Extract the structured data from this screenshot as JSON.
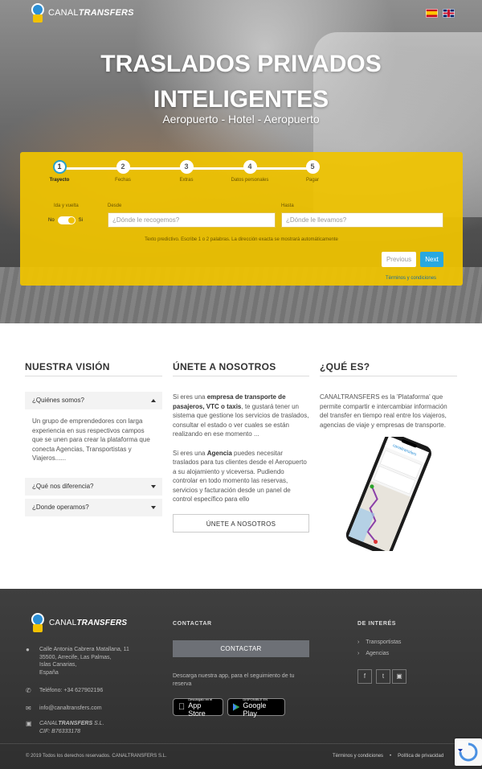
{
  "header": {
    "logo_light": "CANAL",
    "logo_bold": "TRANSFERS",
    "languages": [
      "es-flag",
      "en-flag"
    ]
  },
  "hero": {
    "title_line1": "TRASLADOS PRIVADOS",
    "title_line2": "INTELIGENTES",
    "subtitle": "Aeropuerto - Hotel - Aeropuerto"
  },
  "booking": {
    "steps": [
      {
        "num": "1",
        "label": "Trayecto"
      },
      {
        "num": "2",
        "label": "Fechas"
      },
      {
        "num": "3",
        "label": "Extras"
      },
      {
        "num": "4",
        "label": "Datos personales"
      },
      {
        "num": "5",
        "label": "Pagar"
      }
    ],
    "roundtrip_label": "Ida y vuelta",
    "toggle_no": "No",
    "toggle_yes": "Si",
    "from_label": "Desde",
    "from_placeholder": "¿Dónde le recogemos?",
    "to_label": "Hasta",
    "to_placeholder": "¿Dónde le llevamos?",
    "hint": "Texto predictivo. Escribe 1 o 2 palabras. La dirección exacta se mostrará automáticamente",
    "prev_label": "Previous",
    "next_label": "Next",
    "terms_label": "Términos y condiciones"
  },
  "vision": {
    "title": "NUESTRA VISIÓN",
    "items": [
      {
        "label": "¿Quiénes somos?",
        "body": "Un grupo de emprendedores con larga experiencia en sus respectivos campos que se unen para crear la plataforma que conecta Agencias, Transportistas y Viajeros......"
      },
      {
        "label": "¿Qué nos diferencia?"
      },
      {
        "label": "¿Donde operamos?"
      }
    ]
  },
  "join": {
    "title": "ÚNETE A NOSOTROS",
    "p1_pre": "Si eres una ",
    "p1_bold": "empresa de transporte de pasajeros, VTC o taxis",
    "p1_post": ", te gustará tener un sistema que gestione los servicios de traslados, consultar el estado o ver cuales se están realizando en ese momento ...",
    "p2_pre": "Si eres una ",
    "p2_bold": "Agencia",
    "p2_post": " puedes necesitar traslados para tus clientes desde el Aeropuerto a su alojamiento y viceversa. Pudiendo controlar en todo momento las reservas, servicios y facturación desde un panel de control específico para ello",
    "button": "ÚNETE A NOSOTROS"
  },
  "what": {
    "title": "¿QUÉ ES?",
    "text": "CANALTRANSFERS es la 'Plataforma' que permite compartir e intercambiar información del transfer en tiempo real entre los viajeros, agencias de viaje y empresas de transporte.",
    "app_name": "canaltransfers"
  },
  "footer": {
    "logo_light": "CANAL",
    "logo_bold": "TRANSFERS",
    "address": [
      "Calle Antonia Cabrera Matallana, 11",
      "35500, Arrecife, Las Palmas,",
      "Islas Canarias,",
      "España"
    ],
    "phone": "Teléfono: +34 627902196",
    "email": "info@canaltransfers.com",
    "company_pre": "CANAL",
    "company_bold": "TRANSFERS",
    "company_post": " S.L.",
    "cif": "CIF: B76333178",
    "contact_title": "CONTACTAR",
    "contact_button": "CONTACTAR",
    "app_text": "Descarga nuestra app, para el seguimiento de tu reserva",
    "appstore_small": "Descárgalo en el",
    "appstore_big": "App Store",
    "gplay_small": "DISPONIBLE EN",
    "gplay_big": "Google Play",
    "interest_title": "DE INTERÉS",
    "interest_links": [
      "Transportistas",
      "Agencias"
    ],
    "copyright": "© 2019 Todos los derechos reservados. CANALTRANSFERS S.L.",
    "terms": "Términos y condiciones",
    "sep": "•",
    "privacy": "Política de privacidad"
  },
  "colors": {
    "panel_yellow": "#f0c400",
    "next_blue": "#28a8e0",
    "active_step_ring": "#2aa2c8"
  }
}
